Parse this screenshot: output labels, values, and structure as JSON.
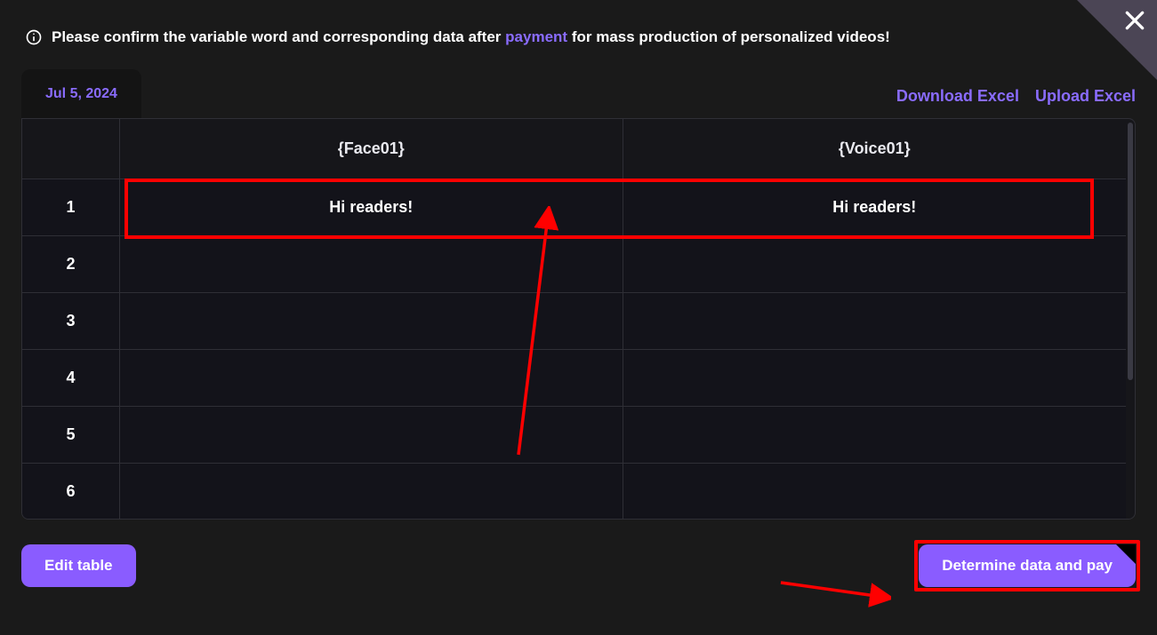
{
  "header": {
    "info_pre": "Please confirm the variable word and corresponding data after",
    "info_em": "payment",
    "info_post": "for mass production of personalized videos!"
  },
  "toolbar": {
    "date_tab": "Jul 5, 2024",
    "download_label": "Download Excel",
    "upload_label": "Upload Excel"
  },
  "table": {
    "columns": [
      "{Face01}",
      "{Voice01}"
    ],
    "rows": [
      {
        "num": "1",
        "cells": [
          "Hi readers!",
          "Hi readers!"
        ]
      },
      {
        "num": "2",
        "cells": [
          "",
          ""
        ]
      },
      {
        "num": "3",
        "cells": [
          "",
          ""
        ]
      },
      {
        "num": "4",
        "cells": [
          "",
          ""
        ]
      },
      {
        "num": "5",
        "cells": [
          "",
          ""
        ]
      },
      {
        "num": "6",
        "cells": [
          "",
          ""
        ]
      }
    ]
  },
  "footer": {
    "edit_label": "Edit table",
    "pay_label": "Determine data and pay"
  }
}
